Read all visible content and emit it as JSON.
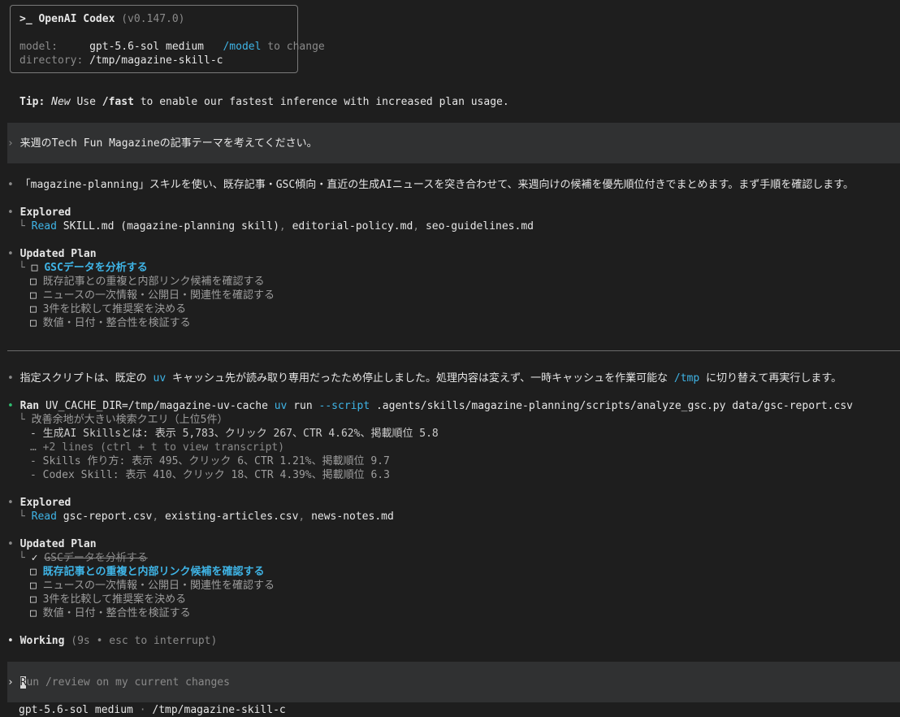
{
  "header": {
    "prompt_symbol": ">_",
    "app_name": "OpenAI Codex",
    "version": "(v0.147.0)",
    "model_label": "model:",
    "model_value": "gpt-5.6-sol medium",
    "model_cmd": "/model",
    "model_hint": "to change",
    "directory_label": "directory:",
    "directory_value": "/tmp/magazine-skill-c"
  },
  "tip": {
    "label": "Tip:",
    "new": "New",
    "text1": "Use",
    "cmd": "/fast",
    "text2": "to enable our fastest inference with increased plan usage."
  },
  "user_message": "来週のTech Fun Magazineの記事テーマを考えてください。",
  "transcript": {
    "intro": "「magazine-planning」スキルを使い、既存記事・GSC傾向・直近の生成AIニュースを突き合わせて、来週向けの候補を優先順位付きでまとめます。まず手順を確認します。",
    "explored1": {
      "title": "Explored",
      "verb": "Read",
      "files": "SKILL.md (magazine-planning skill)",
      "file2": "editorial-policy.md",
      "file3": "seo-guidelines.md"
    },
    "plan1": {
      "title": "Updated Plan",
      "items": [
        "GSCデータを分析する",
        "既存記事との重複と内部リンク候補を確認する",
        "ニュースの一次情報・公開日・関連性を確認する",
        "3件を比較して推奨案を決める",
        "数値・日付・整合性を検証する"
      ]
    },
    "notice": {
      "t1": "指定スクリプトは、既定の",
      "uv": "uv",
      "t2": "キャッシュ先が読み取り専用だったため停止しました。処理内容は変えず、一時キャッシュを作業可能な",
      "tmp": "/tmp",
      "t3": "に切り替えて再実行します。"
    },
    "ran": {
      "verb": "Ran",
      "env": "UV_CACHE_DIR=/tmp/magazine-uv-cache",
      "uv": "uv",
      "run": "run",
      "flag": "--script",
      "path": ".agents/skills/magazine-planning/scripts/analyze_gsc.py data/gsc-report.csv",
      "out": [
        "改善余地が大きい検索クエリ（上位5件）",
        "- 生成AI Skillsとは: 表示 5,783、クリック 267、CTR 4.62%、掲載順位 5.8",
        "… +2 lines (ctrl + t to view transcript)",
        "- Skills 作り方: 表示 495、クリック 6、CTR 1.21%、掲載順位 9.7",
        "- Codex Skill: 表示 410、クリック 18、CTR 4.39%、掲載順位 6.3"
      ]
    },
    "explored2": {
      "title": "Explored",
      "verb": "Read",
      "file1": "gsc-report.csv",
      "file2": "existing-articles.csv",
      "file3": "news-notes.md"
    },
    "plan2": {
      "title": "Updated Plan",
      "done": "GSCデータを分析する",
      "active": "既存記事との重複と内部リンク候補を確認する",
      "items": [
        "ニュースの一次情報・公開日・関連性を確認する",
        "3件を比較して推奨案を決める",
        "数値・日付・整合性を検証する"
      ]
    },
    "working": {
      "label": "Working",
      "status": "(9s • esc to interrupt)"
    }
  },
  "composer": {
    "cursor_char": "R",
    "placeholder_rest": "un /review on my current changes"
  },
  "footer": {
    "model": "gpt-5.6-sol medium",
    "sep": "·",
    "path": "/tmp/magazine-skill-c"
  },
  "symbols": {
    "bullet": "•",
    "tree": "└",
    "checkbox": "□",
    "check": "✓",
    "chevron": "›"
  },
  "colors": {
    "background": "#1e1e1e",
    "accent_cyan": "#3fb4e6",
    "success_green": "#2fbf71",
    "band": "#303132"
  }
}
